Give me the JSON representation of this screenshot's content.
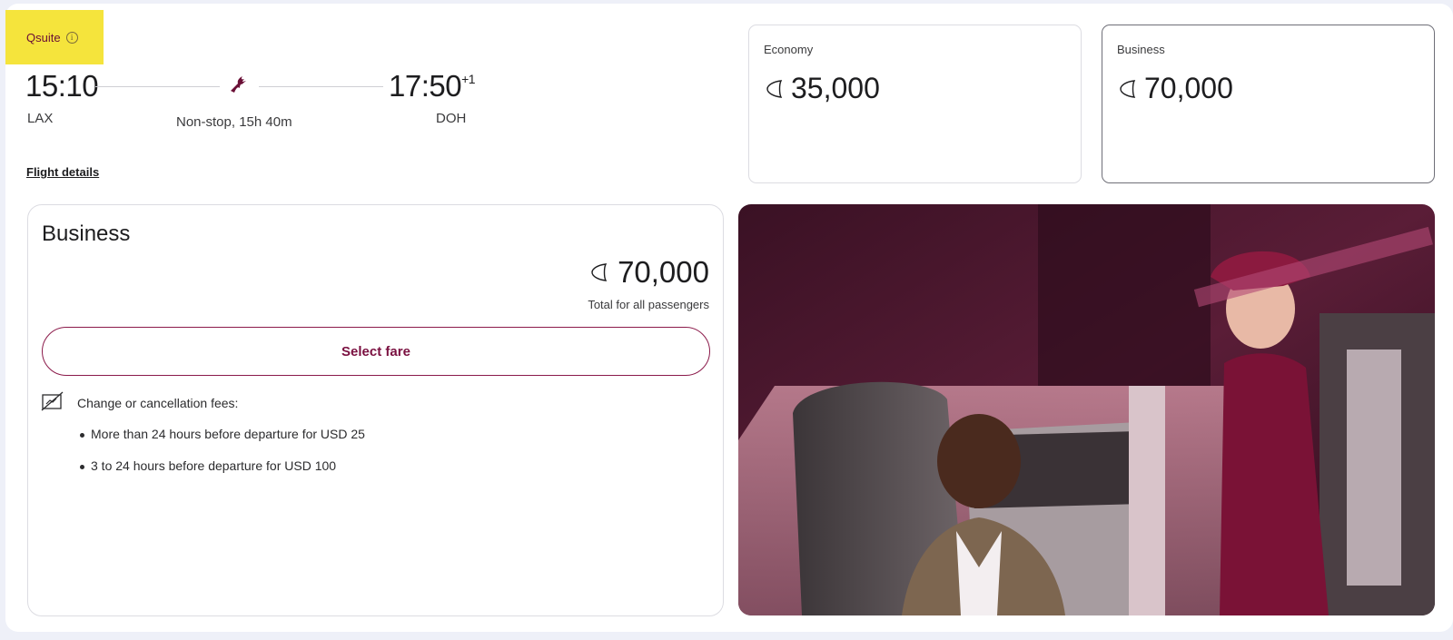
{
  "tag": {
    "label": "Qsuite",
    "info_icon": "info-circle-icon"
  },
  "flight": {
    "departure_time": "15:10",
    "arrival_time": "17:50",
    "arrival_day_offset": "+1",
    "origin": "LAX",
    "destination": "DOH",
    "duration": "Non-stop, 15h 40m",
    "airline_icon": "oryx-logo-icon",
    "details_link": "Flight details"
  },
  "fares": [
    {
      "label": "Economy",
      "value": "35,000",
      "selected": false
    },
    {
      "label": "Business",
      "value": "70,000",
      "selected": true
    }
  ],
  "panel": {
    "title": "Business",
    "price": "70,000",
    "price_note": "Total for all passengers",
    "select_label": "Select fare",
    "fees_title": "Change or cancellation fees:",
    "fees": [
      "More than 24 hours before departure for USD 25",
      "3 to 24 hours before departure for USD 100"
    ]
  },
  "colors": {
    "brand": "#7a1040",
    "tag_bg": "#f5e43c",
    "page_bg": "#eef0f8"
  }
}
